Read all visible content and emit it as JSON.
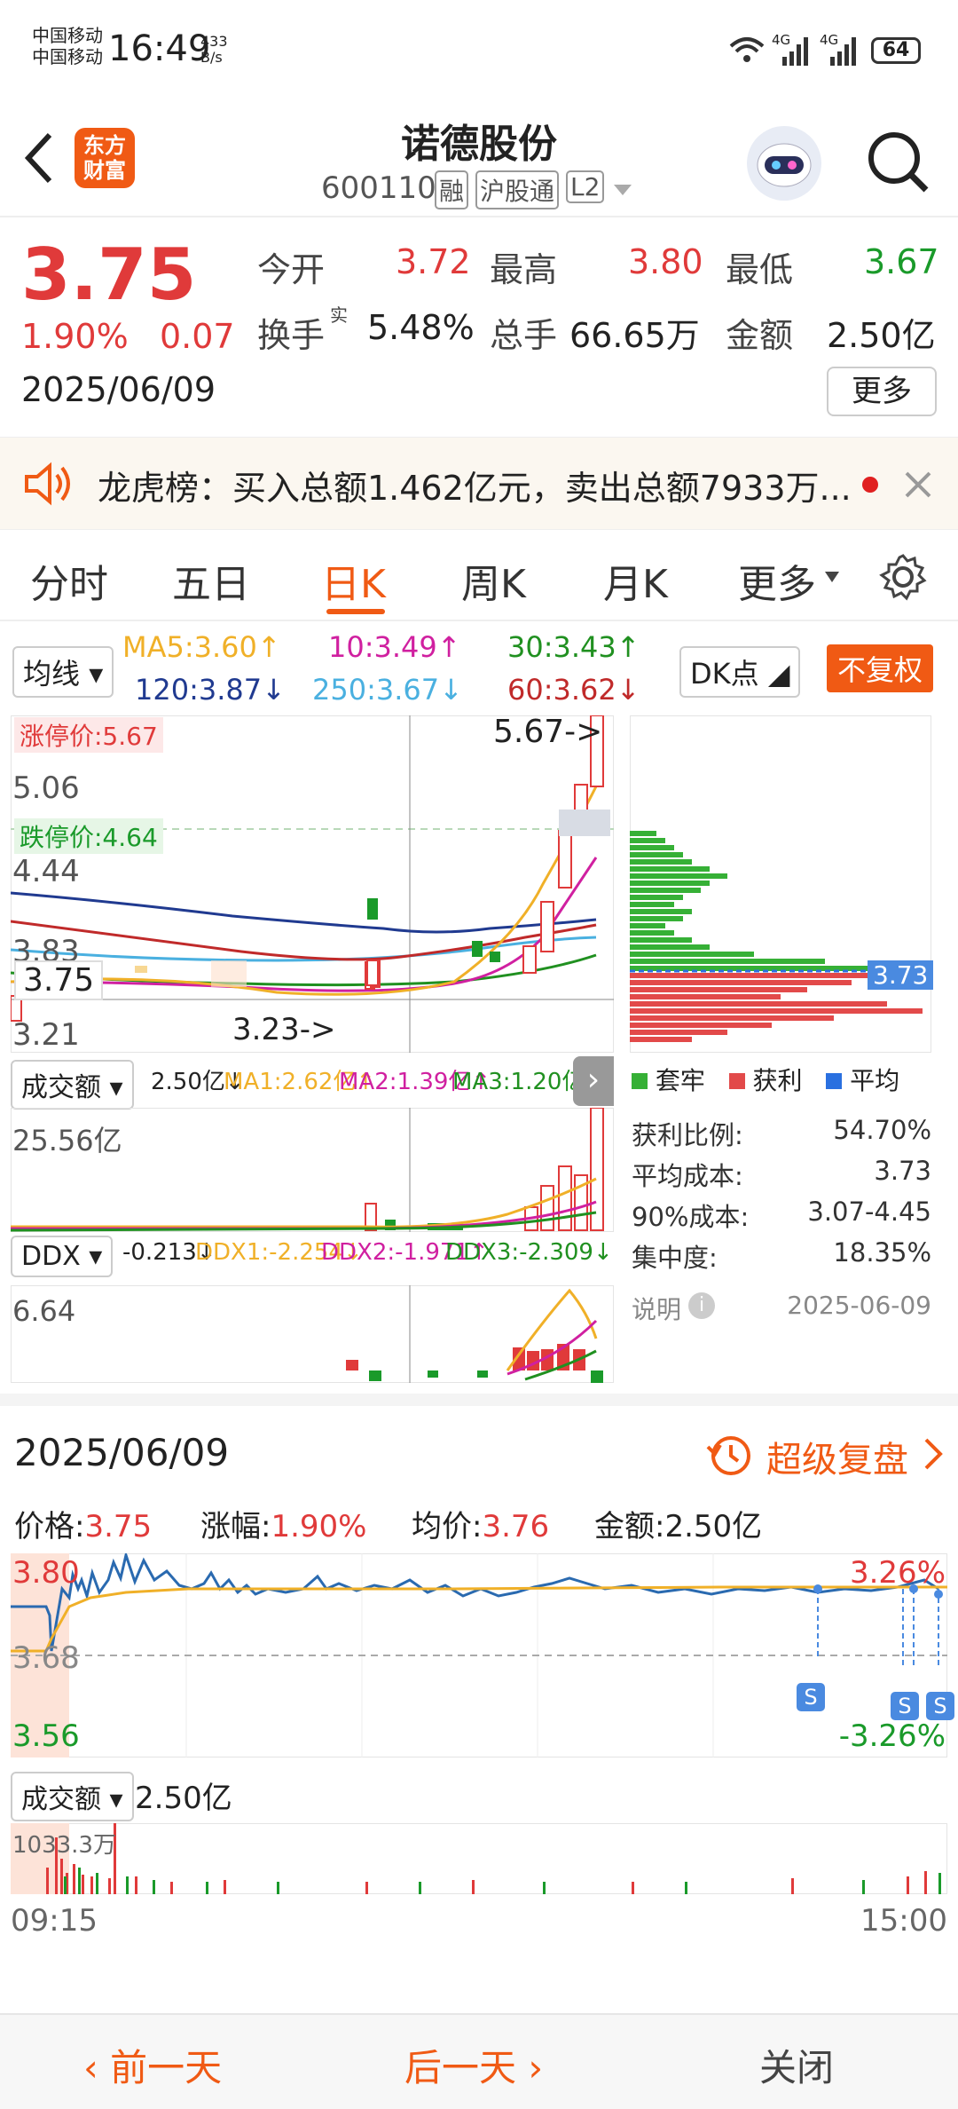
{
  "status": {
    "carrier1": "中国移动",
    "carrier2": "中国移动",
    "time": "16:49",
    "netspeed_num": "433",
    "netspeed_unit": "B/s",
    "signal1": "4G",
    "signal2": "4G",
    "battery": "64"
  },
  "header": {
    "logo_line1": "东方",
    "logo_line2": "财富",
    "title": "诺德股份",
    "code": "600110",
    "tag_margin": "融",
    "tag_connect": "沪股通",
    "tag_level": "L2"
  },
  "quote": {
    "price": "3.75",
    "change_pct": "1.90%",
    "change_amt": "0.07",
    "date": "2025/06/09",
    "open_label": "今开",
    "open": "3.72",
    "high_label": "最高",
    "high": "3.80",
    "low_label": "最低",
    "low": "3.67",
    "turnover_label": "换手",
    "turnover_sup": "实",
    "turnover": "5.48%",
    "volume_label": "总手",
    "volume": "66.65万",
    "amount_label": "金额",
    "amount": "2.50亿",
    "more_label": "更多"
  },
  "notice": {
    "text": "龙虎榜：买入总额1.462亿元，卖出总额7933万..."
  },
  "tabs": [
    "分时",
    "五日",
    "日K",
    "周K",
    "月K",
    "更多"
  ],
  "kline": {
    "ma_select": "均线",
    "ma5": "MA5:3.60↑",
    "ma10": "10:3.49↑",
    "ma30": "30:3.43↑",
    "ma120": "120:3.87↓",
    "ma250": "250:3.67↓",
    "ma60": "60:3.62↓",
    "dk_label": "DK点",
    "fq_label": "不复权",
    "limit_up": "涨停价:5.67",
    "limit_down": "跌停价:4.64",
    "y_5_06": "5.06",
    "y_4_44": "4.44",
    "y_3_83": "3.83",
    "y_3_21": "3.21",
    "cur_price": "3.75",
    "high_mark": "5.67->",
    "low_mark": "3.23->",
    "cursor_price": "3.73"
  },
  "volume": {
    "select": "成交额",
    "val": "2.50亿↓",
    "ma1": "MA1:2.62亿↑",
    "ma2": "MA2:1.39亿↑",
    "ma3": "MA3:1.20亿↑",
    "ymax": "25.56亿"
  },
  "ddx": {
    "select": "DDX",
    "val": "-0.213↓",
    "ddx1": "DDX1:-2.254↓",
    "ddx2": "DDX2:-1.971↑",
    "ddx3": "DDX3:-2.309↓",
    "ymax": "6.64"
  },
  "chips": {
    "legend": [
      "套牢",
      "获利",
      "平均"
    ],
    "rows": [
      [
        "获利比例:",
        "54.70%"
      ],
      [
        "平均成本:",
        "3.73"
      ],
      [
        "90%成本:",
        "3.07-4.45"
      ],
      [
        "集中度:",
        "18.35%"
      ]
    ],
    "note_label": "说明",
    "note_date": "2025-06-09"
  },
  "day": {
    "date": "2025/06/09",
    "replay": "超级复盘",
    "price_label": "价格:",
    "price": "3.75",
    "chg_label": "涨幅:",
    "chg": "1.90%",
    "avg_label": "均价:",
    "avg": "3.76",
    "amt_label": "金额:",
    "amt": "2.50亿",
    "y_top": "3.80",
    "y_mid": "3.68",
    "y_bot": "3.56",
    "pct_top": "3.26%",
    "pct_bot": "-3.26%",
    "vol_select": "成交额",
    "vol_val": "2.50亿",
    "vol_max": "1033.3万",
    "t_start": "09:15",
    "t_end": "15:00"
  },
  "bottom": {
    "prev": "前一天",
    "next": "后一天",
    "close": "关闭"
  },
  "colors": {
    "red": "#e03a3a",
    "green": "#1a9a2a",
    "accent": "#f05a14",
    "ma5": "#f0b028",
    "ma10": "#d020a0",
    "ma30": "#209020",
    "ma120": "#203a90",
    "ma250": "#4ab0e0",
    "ma60": "#c02a2a"
  }
}
